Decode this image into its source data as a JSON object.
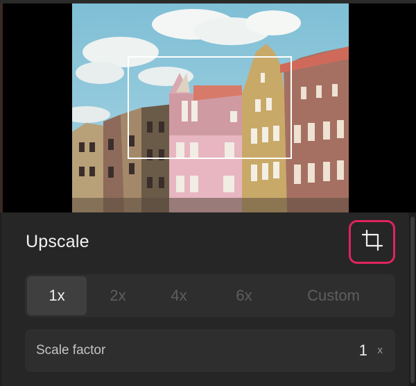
{
  "panel": {
    "title": "Upscale"
  },
  "crop_button": {
    "icon": "crop-icon",
    "accent_color": "#e0245e"
  },
  "scale_options": [
    {
      "label": "1x",
      "selected": true
    },
    {
      "label": "2x",
      "selected": false
    },
    {
      "label": "4x",
      "selected": false
    },
    {
      "label": "6x",
      "selected": false
    },
    {
      "label": "Custom",
      "selected": false
    }
  ],
  "scale_factor": {
    "label": "Scale factor",
    "value": "1",
    "unit": "x"
  }
}
